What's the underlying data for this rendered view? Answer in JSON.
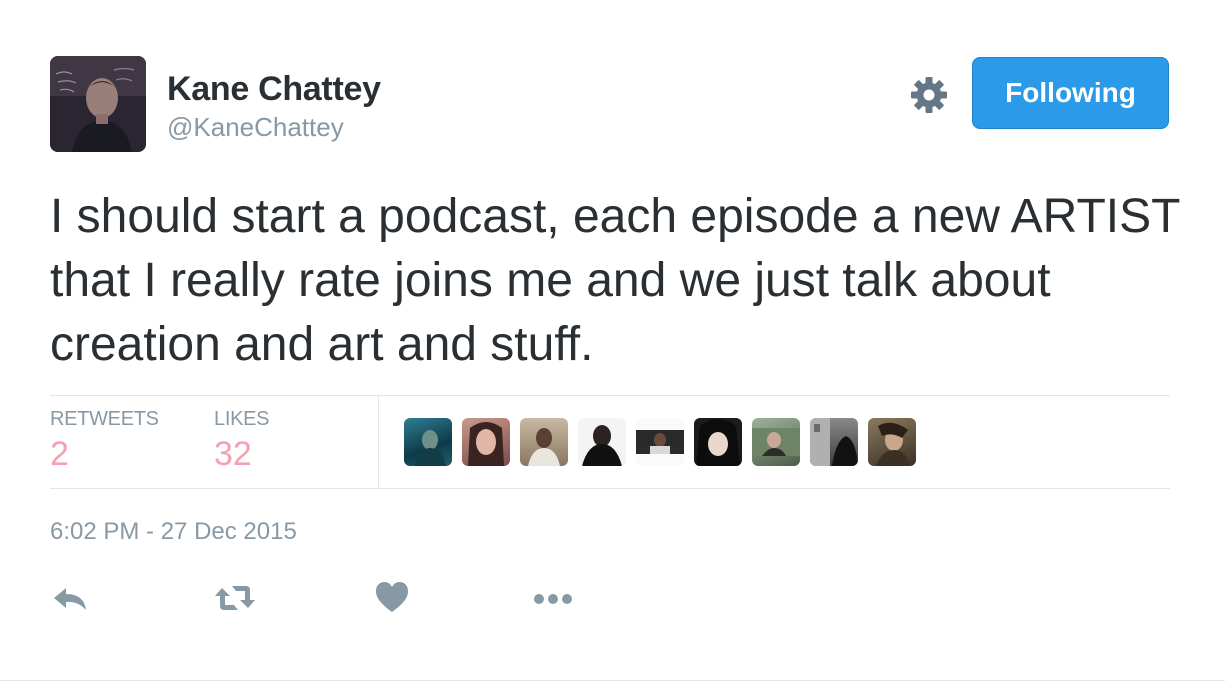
{
  "author": {
    "name": "Kane Chattey",
    "handle": "@KaneChattey"
  },
  "header": {
    "follow_label": "Following",
    "settings_icon": "gear-icon"
  },
  "tweet": {
    "text": "I should start a podcast, each episode a new ARTIST that I really rate joins me and we just talk about creation and art and stuff.",
    "timestamp": "6:02 PM - 27 Dec 2015"
  },
  "stats": {
    "retweets_label": "RETWEETS",
    "retweets_count": "2",
    "likes_label": "LIKES",
    "likes_count": "32"
  },
  "likers": [
    {
      "name": "liker-avatar-1"
    },
    {
      "name": "liker-avatar-2"
    },
    {
      "name": "liker-avatar-3"
    },
    {
      "name": "liker-avatar-4"
    },
    {
      "name": "liker-avatar-5"
    },
    {
      "name": "liker-avatar-6"
    },
    {
      "name": "liker-avatar-7"
    },
    {
      "name": "liker-avatar-8"
    },
    {
      "name": "liker-avatar-9"
    }
  ],
  "actions": [
    "reply-icon",
    "retweet-icon",
    "heart-icon",
    "more-icon"
  ],
  "colors": {
    "accent": "#2b9ae8",
    "muted_text": "#8899a6",
    "count_text": "#f4a1b3",
    "divider": "#e1e8ed"
  }
}
